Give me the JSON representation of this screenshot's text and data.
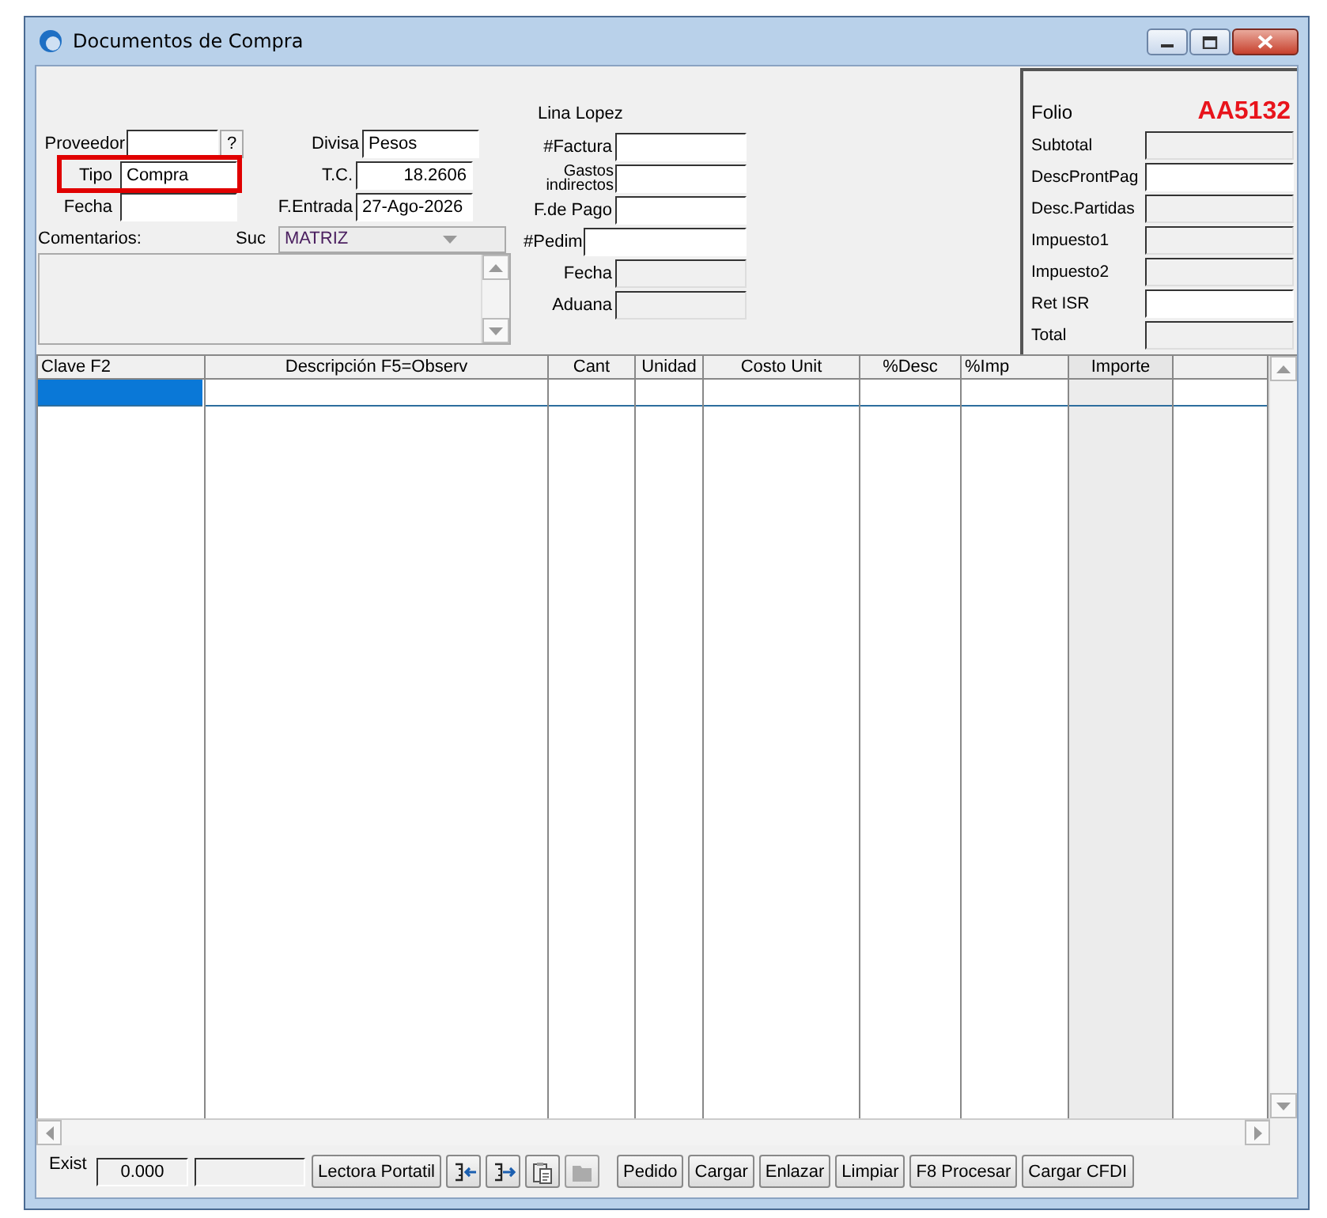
{
  "window": {
    "title": "Documentos de Compra"
  },
  "left_form": {
    "rows": [
      {
        "label": "Proveedor",
        "help": "?",
        "highlighted": false,
        "right_label": "Divisa",
        "right_value": "Pesos"
      },
      {
        "label": "Tipo",
        "value": "Compra",
        "highlighted": true,
        "right_label": "T.C.",
        "right_value": "18.2606"
      },
      {
        "label": "Fecha",
        "highlighted": false,
        "right_label": "F.Entrada",
        "right_value": "27-Ago-2026"
      }
    ],
    "comments_label": "Comentarios:",
    "branch_label": "Suc",
    "branch_value": "MATRIZ"
  },
  "middle_form": {
    "user": "Lina Lopez",
    "fields": [
      {
        "label": "#Factura",
        "editable": true
      },
      {
        "label": "Gastos indirectos",
        "editable": true
      },
      {
        "label": "F.de Pago",
        "editable": true
      },
      {
        "label": "#Pedim",
        "editable": true
      },
      {
        "label": "Fecha",
        "editable": false
      },
      {
        "label": "Aduana",
        "editable": false
      }
    ]
  },
  "totals": {
    "folio_label": "Folio",
    "folio": "AA5132",
    "fields": [
      {
        "label": "Subtotal",
        "editable": false
      },
      {
        "label": "DescProntPag",
        "editable": true
      },
      {
        "label": "Desc.Partidas",
        "editable": false
      },
      {
        "label": "Impuesto1",
        "editable": false
      },
      {
        "label": "Impuesto2",
        "editable": false
      },
      {
        "label": "Ret ISR",
        "editable": true
      },
      {
        "label": "Total",
        "editable": false
      }
    ]
  },
  "table": {
    "columns": [
      {
        "label": "Clave  F2",
        "shaded": false
      },
      {
        "label": "Descripción  F5=Observ",
        "shaded": false
      },
      {
        "label": "Cant",
        "shaded": false
      },
      {
        "label": "Unidad",
        "shaded": false
      },
      {
        "label": "Costo Unit",
        "shaded": false
      },
      {
        "label": "%Desc",
        "shaded": false
      },
      {
        "label": "%Imp",
        "shaded": false
      },
      {
        "label": "Importe",
        "shaded": true
      },
      {
        "shaded": false
      }
    ],
    "rows": [
      {
        "selected": true
      }
    ]
  },
  "footer": {
    "exist_label": "Exist",
    "exist_value": "0.000",
    "buttons": [
      {
        "kind": "text",
        "label": "Lectora Portatil"
      },
      {
        "kind": "icon",
        "disabled": false
      },
      {
        "kind": "icon",
        "disabled": false
      },
      {
        "kind": "icon",
        "disabled": false
      },
      {
        "kind": "icon",
        "disabled": true
      },
      {
        "kind": "text",
        "label": "Pedido"
      },
      {
        "kind": "text",
        "label": "Cargar"
      },
      {
        "kind": "text",
        "label": "Enlazar"
      },
      {
        "kind": "text",
        "label": "Limpiar"
      },
      {
        "kind": "text",
        "label": "F8 Procesar"
      },
      {
        "kind": "text",
        "label": "Cargar CFDI"
      }
    ]
  }
}
